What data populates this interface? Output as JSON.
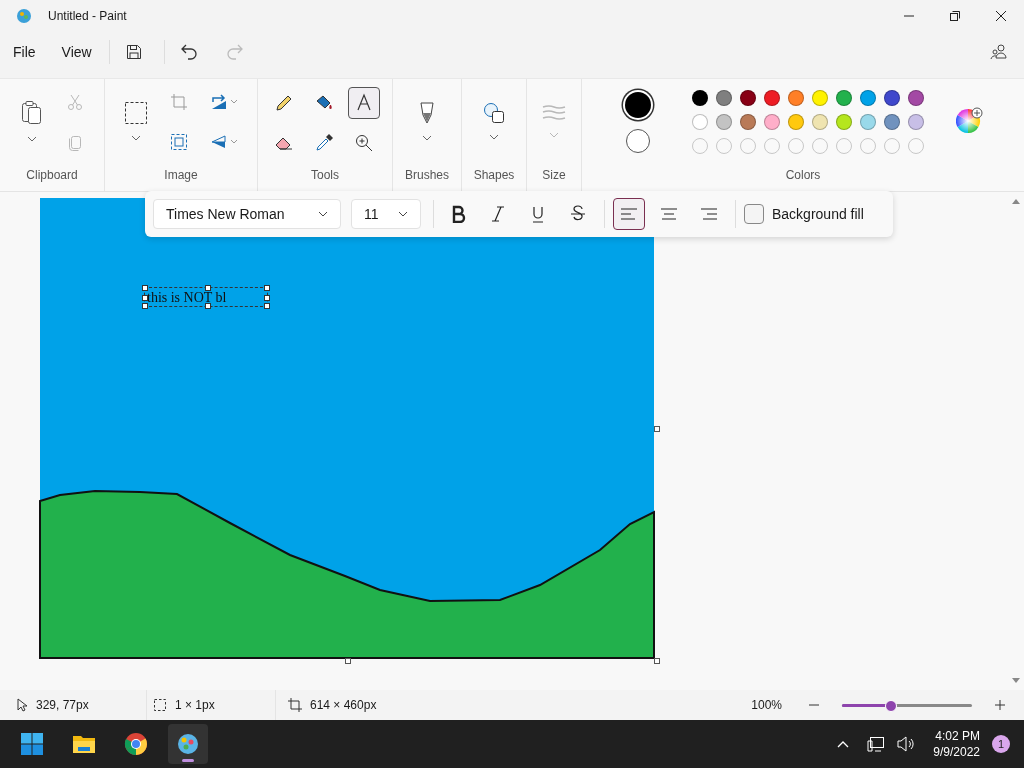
{
  "window": {
    "title": "Untitled - Paint"
  },
  "menu": [
    {
      "label": "File"
    },
    {
      "label": "View"
    }
  ],
  "quick_actions": [
    {
      "kind": "save",
      "disabled": false
    },
    {
      "kind": "undo",
      "disabled": false
    },
    {
      "kind": "redo",
      "disabled": true
    }
  ],
  "ribbon": {
    "groups": [
      {
        "kind": "clipboard",
        "label": "Clipboard"
      },
      {
        "kind": "image",
        "label": "Image"
      },
      {
        "kind": "tools",
        "label": "Tools"
      },
      {
        "kind": "brushes",
        "label": "Brushes"
      },
      {
        "kind": "shapes",
        "label": "Shapes"
      },
      {
        "kind": "size",
        "label": "Size"
      },
      {
        "kind": "colors",
        "label": "Colors"
      }
    ],
    "clipboard": [
      {
        "kind": "cut",
        "disabled": true
      },
      {
        "kind": "copy",
        "disabled": true
      }
    ],
    "size_button": {
      "disabled": true
    },
    "tools": [
      {
        "kind": "pencil",
        "selected": false
      },
      {
        "kind": "fill",
        "selected": false
      },
      {
        "kind": "text",
        "selected": true
      },
      {
        "kind": "eraser",
        "selected": false
      },
      {
        "kind": "picker",
        "selected": false
      },
      {
        "kind": "magnifier",
        "selected": false
      }
    ],
    "colors": {
      "current": [
        {
          "kind": "primary",
          "color": "#000000"
        },
        {
          "kind": "secondary",
          "color": "#ffffff"
        }
      ],
      "palette": [
        {
          "color": "#000000"
        },
        {
          "color": "#7f7f7f"
        },
        {
          "color": "#880015"
        },
        {
          "color": "#ed1c24"
        },
        {
          "color": "#ff7f27"
        },
        {
          "color": "#fff200"
        },
        {
          "color": "#22b14c"
        },
        {
          "color": "#00a2e8"
        },
        {
          "color": "#3f48cc"
        },
        {
          "color": "#a349a4"
        },
        {
          "color": "#ffffff"
        },
        {
          "color": "#c3c3c3"
        },
        {
          "color": "#b97a57"
        },
        {
          "color": "#ffaec9"
        },
        {
          "color": "#ffc90e"
        },
        {
          "color": "#efe4b0"
        },
        {
          "color": "#b5e61d"
        },
        {
          "color": "#99d9ea"
        },
        {
          "color": "#7092be"
        },
        {
          "color": "#c8bfe7"
        }
      ]
    }
  },
  "text_toolbar": {
    "font": "Times New Roman",
    "size": "11",
    "styles": [
      {
        "kind": "bold",
        "on": false
      },
      {
        "kind": "italic",
        "on": false
      },
      {
        "kind": "underline",
        "on": false
      },
      {
        "kind": "strikethrough",
        "on": false
      }
    ],
    "align": [
      {
        "kind": "left",
        "selected": true
      },
      {
        "kind": "center",
        "selected": false
      },
      {
        "kind": "right",
        "selected": false
      }
    ],
    "background_fill": {
      "label": "Background fill",
      "checked": false
    }
  },
  "canvas": {
    "text_box": "this is NOT bl"
  },
  "status_bar": {
    "cursor": "329, 77px",
    "selection": "1 × 1px",
    "canvas_size": "614 × 460px",
    "zoom": "100%",
    "zoom_slider": {
      "level": 0.38
    }
  },
  "taskbar": {
    "apps": [
      {
        "kind": "start",
        "selected": false
      },
      {
        "kind": "explorer",
        "selected": false
      },
      {
        "kind": "chrome",
        "selected": false
      },
      {
        "kind": "paint",
        "selected": true
      }
    ],
    "time": "4:02 PM",
    "date": "9/9/2022",
    "notifications": "1"
  }
}
